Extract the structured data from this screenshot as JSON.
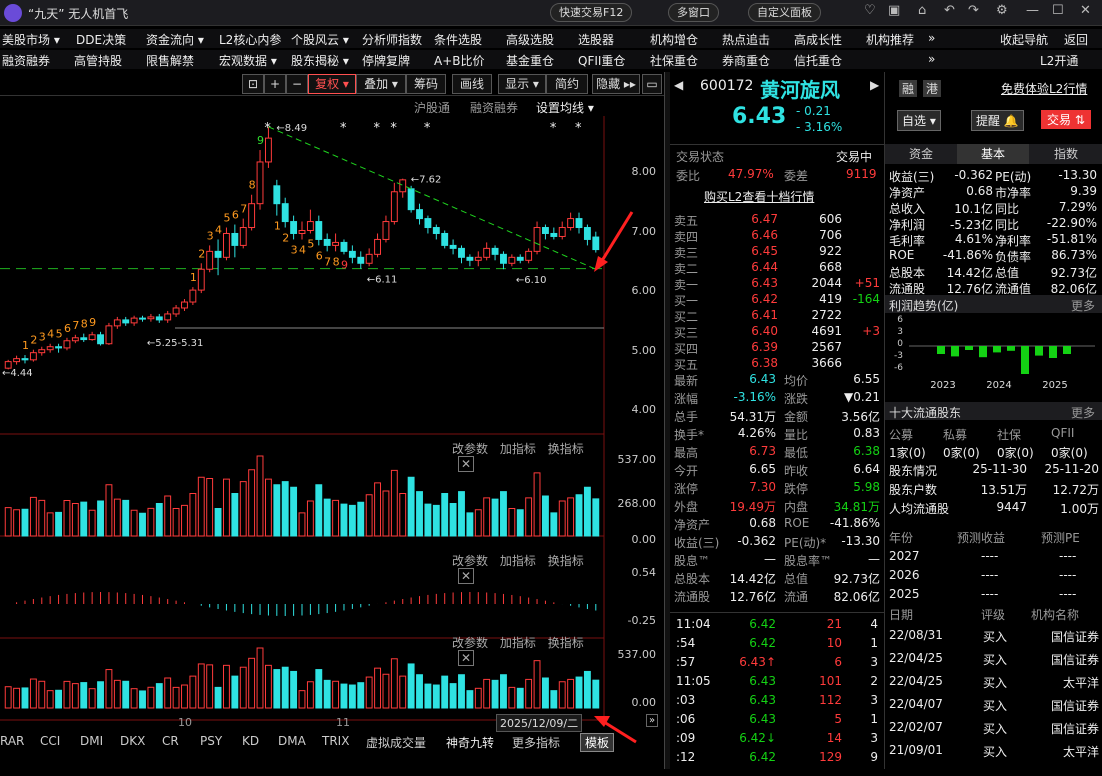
{
  "app": {
    "title": "“九天” 无人机首飞",
    "quick_trade": "快速交易F12",
    "multi_window": "多窗口",
    "custom_panel": "自定义面板"
  },
  "menu1": [
    "美股市场 ▾",
    "DDE决策",
    "资金流向 ▾",
    "L2核心内参",
    "个股风云 ▾",
    "分析师指数",
    "条件选股",
    "高级选股",
    "选股器",
    "机构增仓",
    "热点追击",
    "高成长性",
    "机构推荐",
    "»",
    "收起导航",
    "返回"
  ],
  "menu2": [
    "融资融券",
    "高管持股",
    "限售解禁",
    "宏观数据 ▾",
    "股东揭秘 ▾",
    "停牌复牌",
    "A+B比价",
    "基金重仓",
    "QFII重仓",
    "社保重仓",
    "券商重仓",
    "信托重仓",
    "»",
    "L2开通"
  ],
  "toolbar": {
    "plus": "+",
    "minus": "−",
    "fuquan": "复权 ▾",
    "overlay": "叠加 ▾",
    "chips": "筹码",
    "draw": "画线",
    "display": "显示 ▾",
    "simple": "简约",
    "hide": "隐藏 ▸▸"
  },
  "chart_tabs": {
    "hgt": "沪股通",
    "rzrq": "融资融券",
    "ma": "设置均线 ▾"
  },
  "indicator_ops": {
    "edit": "改参数",
    "add": "加指标",
    "swap": "换指标"
  },
  "date_box": "2025/12/09/二",
  "months": [
    "10",
    "11"
  ],
  "bottom_tabs": [
    "RAR",
    "CCI",
    "DMI",
    "DKX",
    "CR",
    "PSY",
    "KD",
    "DMA",
    "TRIX",
    "虚拟成交量",
    "神奇九转",
    "更多指标",
    "模板"
  ],
  "price_axis": [
    "8.00",
    "7.00",
    "6.00",
    "5.00",
    "4.00"
  ],
  "vol_axis": [
    "537.00",
    "268.00",
    "0.00"
  ],
  "macd_axis": [
    "0.54",
    "-0.25"
  ],
  "vol2_axis": [
    "537.00",
    "0.00"
  ],
  "annotations": {
    "high": "8.49",
    "peak2": "7.62",
    "low1": "6.11",
    "low2": "6.10",
    "range": "5.25-5.31",
    "low0": "4.44"
  },
  "chart_data": {
    "type": "candlestick",
    "title": "",
    "ylim": [
      4,
      8.6
    ],
    "tds_counts_up": [
      "1",
      "2",
      "3",
      "4",
      "5",
      "6",
      "7",
      "8",
      "9"
    ],
    "candles": [
      [
        4.44,
        4.55,
        4.42,
        4.58
      ],
      [
        4.55,
        4.6,
        4.5,
        4.65
      ],
      [
        4.6,
        4.58,
        4.52,
        4.66
      ],
      [
        4.58,
        4.7,
        4.55,
        4.75
      ],
      [
        4.7,
        4.75,
        4.65,
        4.8
      ],
      [
        4.75,
        4.8,
        4.7,
        4.85
      ],
      [
        4.8,
        4.78,
        4.7,
        4.85
      ],
      [
        4.78,
        4.9,
        4.74,
        4.95
      ],
      [
        4.9,
        4.95,
        4.86,
        5.0
      ],
      [
        4.95,
        4.92,
        4.88,
        5.02
      ],
      [
        4.92,
        5.0,
        4.9,
        5.05
      ],
      [
        5.0,
        4.85,
        4.82,
        5.05
      ],
      [
        4.85,
        5.15,
        4.83,
        5.2
      ],
      [
        5.15,
        5.25,
        5.1,
        5.3
      ],
      [
        5.25,
        5.2,
        5.15,
        5.3
      ],
      [
        5.2,
        5.28,
        5.15,
        5.32
      ],
      [
        5.28,
        5.27,
        5.22,
        5.32
      ],
      [
        5.27,
        5.3,
        5.22,
        5.35
      ],
      [
        5.3,
        5.25,
        5.2,
        5.35
      ],
      [
        5.25,
        5.35,
        5.2,
        5.4
      ],
      [
        5.35,
        5.45,
        5.3,
        5.5
      ],
      [
        5.45,
        5.55,
        5.4,
        5.6
      ],
      [
        5.55,
        5.75,
        5.5,
        5.8
      ],
      [
        5.75,
        6.1,
        5.7,
        6.2
      ],
      [
        6.1,
        6.4,
        6.05,
        6.5
      ],
      [
        6.4,
        6.3,
        6.0,
        6.6
      ],
      [
        6.3,
        6.7,
        6.25,
        6.8
      ],
      [
        6.7,
        6.5,
        6.3,
        6.85
      ],
      [
        6.5,
        6.8,
        6.45,
        6.95
      ],
      [
        6.8,
        7.2,
        6.75,
        7.35
      ],
      [
        7.2,
        7.9,
        7.1,
        8.1
      ],
      [
        7.9,
        8.3,
        7.8,
        8.49
      ],
      [
        7.5,
        7.2,
        7.0,
        7.6
      ],
      [
        7.2,
        6.9,
        6.8,
        7.3
      ],
      [
        6.9,
        6.7,
        6.6,
        7.0
      ],
      [
        6.7,
        6.75,
        6.6,
        6.9
      ],
      [
        6.75,
        6.9,
        6.7,
        7.1
      ],
      [
        6.9,
        6.6,
        6.5,
        7.0
      ],
      [
        6.6,
        6.5,
        6.4,
        6.7
      ],
      [
        6.5,
        6.55,
        6.4,
        6.7
      ],
      [
        6.55,
        6.4,
        6.35,
        6.6
      ],
      [
        6.4,
        6.3,
        6.2,
        6.5
      ],
      [
        6.3,
        6.2,
        6.11,
        6.4
      ],
      [
        6.2,
        6.35,
        6.15,
        6.45
      ],
      [
        6.35,
        6.6,
        6.3,
        6.7
      ],
      [
        6.6,
        6.9,
        6.55,
        7.0
      ],
      [
        6.9,
        7.4,
        6.85,
        7.55
      ],
      [
        7.4,
        7.6,
        7.3,
        7.62
      ],
      [
        7.45,
        7.1,
        7.05,
        7.5
      ],
      [
        7.1,
        6.95,
        6.85,
        7.2
      ],
      [
        6.95,
        6.8,
        6.7,
        7.0
      ],
      [
        6.8,
        6.7,
        6.6,
        6.85
      ],
      [
        6.7,
        6.5,
        6.45,
        6.75
      ],
      [
        6.5,
        6.45,
        6.35,
        6.6
      ],
      [
        6.45,
        6.3,
        6.2,
        6.5
      ],
      [
        6.3,
        6.25,
        6.15,
        6.35
      ],
      [
        6.25,
        6.3,
        6.15,
        6.4
      ],
      [
        6.3,
        6.45,
        6.25,
        6.55
      ],
      [
        6.45,
        6.35,
        6.25,
        6.5
      ],
      [
        6.35,
        6.2,
        6.1,
        6.4
      ],
      [
        6.2,
        6.3,
        6.15,
        6.35
      ],
      [
        6.3,
        6.25,
        6.2,
        6.35
      ],
      [
        6.25,
        6.4,
        6.2,
        6.45
      ],
      [
        6.4,
        6.8,
        6.35,
        6.9
      ],
      [
        6.8,
        6.7,
        6.6,
        6.85
      ],
      [
        6.7,
        6.65,
        6.6,
        6.8
      ],
      [
        6.65,
        6.8,
        6.6,
        6.9
      ],
      [
        6.8,
        6.95,
        6.75,
        7.05
      ],
      [
        6.95,
        6.8,
        6.7,
        7.05
      ],
      [
        6.8,
        6.6,
        6.5,
        6.85
      ],
      [
        6.64,
        6.43,
        6.38,
        6.73
      ]
    ]
  },
  "quote": {
    "code": "600172",
    "name": "黄河旋风",
    "price": "6.43",
    "change": "- 0.21",
    "pct": "- 3.16%",
    "tag1": "融",
    "tag2": "港",
    "free_l2": "免费体验L2行情",
    "selfsel": "自选 ▾",
    "remind": "提醒 🔔",
    "trade": "交易 ⇅",
    "trade_state_label": "交易状态",
    "trade_state": "交易中",
    "weibi_label": "委比",
    "weibi": "47.97%",
    "weicha_label": "委差",
    "weicha": "9119",
    "buy_l2": "购买L2查看十档行情"
  },
  "asks": [
    {
      "l": "卖五",
      "p": "6.47",
      "v": "606",
      "d": ""
    },
    {
      "l": "卖四",
      "p": "6.46",
      "v": "706",
      "d": ""
    },
    {
      "l": "卖三",
      "p": "6.45",
      "v": "922",
      "d": ""
    },
    {
      "l": "卖二",
      "p": "6.44",
      "v": "668",
      "d": ""
    },
    {
      "l": "卖一",
      "p": "6.43",
      "v": "2044",
      "d": "+51"
    }
  ],
  "bids": [
    {
      "l": "买一",
      "p": "6.42",
      "v": "419",
      "d": "-164"
    },
    {
      "l": "买二",
      "p": "6.41",
      "v": "2722",
      "d": ""
    },
    {
      "l": "买三",
      "p": "6.40",
      "v": "4691",
      "d": "+3"
    },
    {
      "l": "买四",
      "p": "6.39",
      "v": "2567",
      "d": ""
    },
    {
      "l": "买五",
      "p": "6.38",
      "v": "3666",
      "d": ""
    }
  ],
  "stats": [
    [
      "最新",
      "6.43",
      "均价",
      "6.55"
    ],
    [
      "涨幅",
      "-3.16%",
      "涨跌",
      "▼0.21"
    ],
    [
      "总手",
      "54.31万",
      "金额",
      "3.56亿"
    ],
    [
      "换手*",
      "4.26%",
      "量比",
      "0.83"
    ],
    [
      "最高",
      "6.73",
      "最低",
      "6.38"
    ],
    [
      "今开",
      "6.65",
      "昨收",
      "6.64"
    ],
    [
      "涨停",
      "7.30",
      "跌停",
      "5.98"
    ],
    [
      "外盘",
      "19.49万",
      "内盘",
      "34.81万"
    ],
    [
      "净资产",
      "0.68",
      "ROE",
      "-41.86%"
    ],
    [
      "收益(三)",
      "-0.362",
      "PE(动)*",
      "-13.30"
    ],
    [
      "股息™",
      "—",
      "股息率™",
      "—"
    ],
    [
      "总股本",
      "14.42亿",
      "总值",
      "92.73亿"
    ],
    [
      "流通股",
      "12.76亿",
      "流通",
      "82.06亿"
    ]
  ],
  "ticks": [
    [
      "11:04",
      "6.42",
      "21",
      "4"
    ],
    [
      ":54",
      "6.42",
      "10",
      "1"
    ],
    [
      ":57",
      "6.43↑",
      "6",
      "3"
    ],
    [
      "11:05",
      "6.43",
      "101",
      "2"
    ],
    [
      ":03",
      "6.43",
      "112",
      "3"
    ],
    [
      ":06",
      "6.43",
      "5",
      "1"
    ],
    [
      ":09",
      "6.42↓",
      "14",
      "3"
    ],
    [
      ":12",
      "6.42",
      "129",
      "9"
    ]
  ],
  "fin_tabs": [
    "资金",
    "基本",
    "指数"
  ],
  "fin": [
    [
      "收益(三)",
      "-0.362",
      "PE(动)",
      "-13.30"
    ],
    [
      "净资产",
      "0.68",
      "市净率",
      "9.39"
    ],
    [
      "总收入",
      "10.1亿",
      "同比",
      "7.29%"
    ],
    [
      "净利润",
      "-5.23亿",
      "同比",
      "-22.90%"
    ],
    [
      "毛利率",
      "4.61%",
      "净利率",
      "-51.81%"
    ],
    [
      "ROE",
      "-41.86%",
      "负债率",
      "86.73%"
    ],
    [
      "总股本",
      "14.42亿",
      "总值",
      "92.73亿"
    ],
    [
      "流通股",
      "12.76亿",
      "流通值",
      "82.06亿"
    ]
  ],
  "profit": {
    "title": "利润趋势(亿)",
    "more": "更多",
    "axis": [
      "6",
      "3",
      "0",
      "-3",
      "-6"
    ],
    "years": [
      "2023",
      "2024",
      "2025"
    ],
    "values": [
      -1.0,
      -1.3,
      -0.5,
      -1.4,
      -0.8,
      -0.6,
      -3.5,
      -1.2,
      -1.5,
      -1.0
    ]
  },
  "holders": {
    "title": "十大流通股东",
    "more": "更多",
    "types": [
      "公募",
      "私募",
      "社保",
      "QFII"
    ],
    "counts": [
      "1家(0)",
      "0家(0)",
      "0家(0)",
      "0家(0)"
    ],
    "rows": [
      [
        "股东情况",
        "25-11-30",
        "25-11-20"
      ],
      [
        "股东户数",
        "13.51万",
        "12.72万"
      ],
      [
        "人均流通股",
        "9447",
        "1.00万"
      ]
    ]
  },
  "forecast": {
    "head": [
      "年份",
      "预测收益",
      "预测PE"
    ],
    "rows": [
      [
        "2027",
        "----",
        "----"
      ],
      [
        "2026",
        "----",
        "----"
      ],
      [
        "2025",
        "----",
        "----"
      ]
    ]
  },
  "rating": {
    "head": [
      "日期",
      "评级",
      "机构名称"
    ],
    "rows": [
      [
        "22/08/31",
        "买入",
        "国信证券"
      ],
      [
        "22/04/25",
        "买入",
        "国信证券"
      ],
      [
        "22/04/25",
        "买入",
        "太平洋"
      ],
      [
        "22/04/07",
        "买入",
        "国信证券"
      ],
      [
        "22/02/07",
        "买入",
        "国信证券"
      ],
      [
        "21/09/01",
        "买入",
        "太平洋"
      ]
    ]
  },
  "colors": {
    "up": "#ff3b3b",
    "down": "#2fe2e2",
    "green": "#14d214",
    "yellow": "#ffd700"
  }
}
